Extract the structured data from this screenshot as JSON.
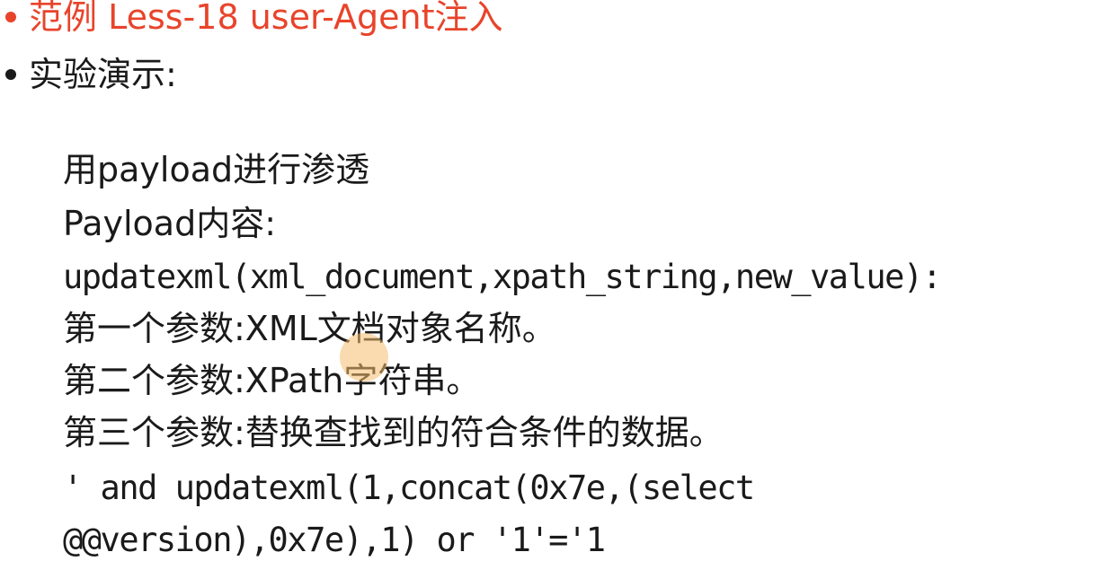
{
  "slide": {
    "bullets": [
      {
        "text": "范例 Less-18 user-Agent注入",
        "color": "#e8442b"
      },
      {
        "text": "实验演示:",
        "color": "#1a1a1a"
      }
    ],
    "body_lines": [
      "用payload进行渗透",
      "Payload内容:",
      "updatexml(xml_document,xpath_string,new_value):",
      "第一个参数:XML文档对象名称。",
      "第二个参数:XPath字符串。",
      "第三个参数:替换查找到的符合条件的数据。",
      "' and updatexml(1,concat(0x7e,(select",
      "@@version),0x7e),1) or '1'='1"
    ]
  }
}
